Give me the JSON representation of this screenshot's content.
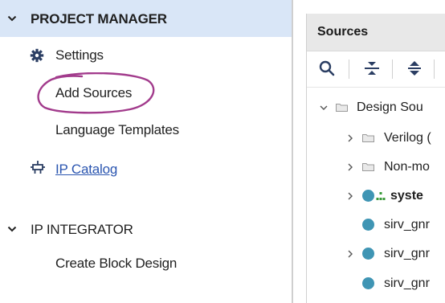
{
  "flow_navigator": {
    "sections": [
      {
        "title": "PROJECT MANAGER",
        "expanded": true,
        "items": [
          {
            "label": "Settings",
            "icon": "gear-icon"
          },
          {
            "label": "Add Sources",
            "annotation": "circled"
          },
          {
            "label": "Language Templates"
          },
          {
            "label": "IP Catalog",
            "icon": "plug-icon",
            "link": true
          }
        ]
      },
      {
        "title": "IP INTEGRATOR",
        "expanded": true,
        "items": [
          {
            "label": "Create Block Design"
          }
        ]
      }
    ]
  },
  "sources_panel": {
    "title": "Sources",
    "toolbar": [
      "search-icon",
      "collapse-all-icon",
      "expand-all-icon"
    ],
    "tree": [
      {
        "label": "Design Sou",
        "type": "folder",
        "expanded": true
      },
      {
        "label": "Verilog (",
        "type": "folder",
        "expanded": false
      },
      {
        "label": "Non-mo",
        "type": "folder",
        "expanded": false
      },
      {
        "label": "syste",
        "type": "top-module",
        "bold": true,
        "expanded": false
      },
      {
        "label": "sirv_gnr",
        "type": "module",
        "expanded": false
      },
      {
        "label": "sirv_gnr",
        "type": "module",
        "expanded": false
      },
      {
        "label": "sirv_gnr",
        "type": "module"
      }
    ]
  },
  "colors": {
    "selected_header": "#d9e6f7",
    "link": "#2a55b0",
    "annotation_circle": "#a23b8c",
    "module_dot": "#3f95b4",
    "hierarchy_icon": "#3a9a3a"
  }
}
